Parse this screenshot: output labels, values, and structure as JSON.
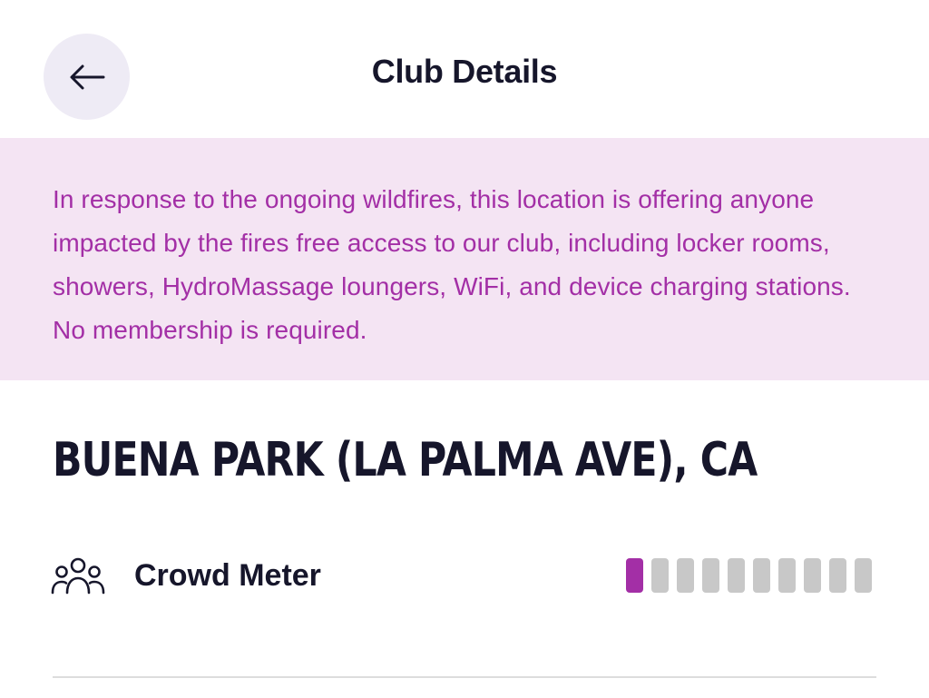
{
  "header": {
    "title": "Club Details",
    "back_icon": "arrow-left-icon"
  },
  "notice": {
    "text": "In response to the ongoing wildfires, this location is offering anyone impacted by the fires free access to our club, including locker rooms, showers, HydroMassage loungers, WiFi, and device charging stations. No membership is required."
  },
  "club": {
    "name": "BUENA PARK (LA PALMA AVE), CA"
  },
  "crowd_meter": {
    "label": "Crowd Meter",
    "icon": "people-group-icon",
    "level": 1,
    "max": 10,
    "active_color": "#a32fa6",
    "inactive_color": "#c8c8c8"
  },
  "colors": {
    "notice_bg": "#f4e4f3",
    "notice_text": "#a32fa6",
    "back_button_bg": "#eeebf5",
    "heading": "#16162b"
  }
}
